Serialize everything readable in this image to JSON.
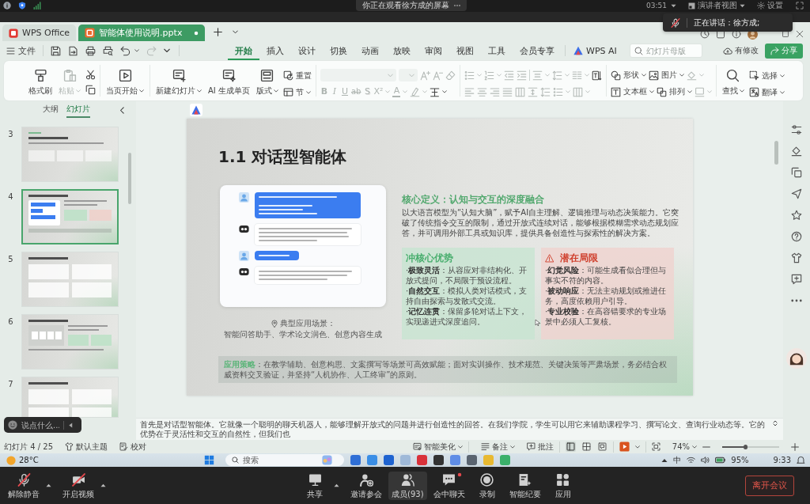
{
  "meeting_top_bar": {
    "banner": "你正在观看徐方成的屏幕",
    "time": "03:51",
    "view_menu": "演讲者视图",
    "settings": "设置"
  },
  "speaking_toast": "正在讲话：徐方成;",
  "app_tabs": [
    {
      "kind": "home",
      "label": "WPS Office",
      "selected": false
    },
    {
      "kind": "document",
      "label": "智能体使用说明.pptx",
      "selected": true
    }
  ],
  "menu_bar": {
    "file": "文件",
    "quick_access": [
      {
        "kind": "save",
        "disabled": false
      },
      {
        "kind": "export",
        "disabled": false
      },
      {
        "kind": "print",
        "disabled": false
      },
      {
        "kind": "preview",
        "disabled": false
      },
      {
        "kind": "undo",
        "disabled": false
      },
      {
        "kind": "redo",
        "disabled": true
      }
    ],
    "tabs": [
      {
        "label": "开始",
        "selected": true
      },
      {
        "label": "插入",
        "selected": false
      },
      {
        "label": "设计",
        "selected": false
      },
      {
        "label": "切换",
        "selected": false
      },
      {
        "label": "动画",
        "selected": false
      },
      {
        "label": "放映",
        "selected": false
      },
      {
        "label": "审阅",
        "selected": false
      },
      {
        "label": "视图",
        "selected": false
      },
      {
        "label": "工具",
        "selected": false
      },
      {
        "label": "会员专享",
        "selected": false
      }
    ],
    "ai_tab": "WPS AI",
    "search": {
      "placeholder": "幻灯片母版"
    },
    "save_status": "有修改",
    "share": "分享"
  },
  "ribbon": {
    "tools": [
      {
        "kind": "format-painter",
        "label": "格式刷",
        "disabled": false
      },
      {
        "kind": "paste",
        "label": "粘贴",
        "disabled": true
      },
      {
        "kind": "play-current",
        "label": "当页开始",
        "disabled": false
      },
      {
        "kind": "new-slide",
        "label": "新建幻灯片",
        "disabled": false
      },
      {
        "kind": "ai-page",
        "label": "AI 生成单页",
        "disabled": false
      },
      {
        "kind": "layout",
        "label": "版式",
        "disabled": false
      }
    ],
    "reset": "重置",
    "section": "节",
    "format_disabled": true,
    "font_glyphs": [
      "B",
      "I",
      "U",
      "ab",
      "S",
      "X²",
      "A"
    ],
    "drawing_tools": [
      "形状",
      "图片",
      "文本框",
      "排列"
    ],
    "find": "查找",
    "select": "选择",
    "translate": "翻译"
  },
  "left_panel": {
    "tabs": [
      {
        "label": "大纲",
        "selected": false
      },
      {
        "label": "幻灯片",
        "selected": true
      }
    ],
    "thumbnails": [
      {
        "number": "3",
        "kind": "columns",
        "selected": false
      },
      {
        "number": "4",
        "kind": "chat",
        "selected": true
      },
      {
        "number": "5",
        "kind": "grid",
        "selected": false
      },
      {
        "number": "6",
        "kind": "split",
        "selected": false
      },
      {
        "number": "7",
        "kind": "grid",
        "selected": false
      }
    ]
  },
  "slide": {
    "title": "1.1 对话型智能体",
    "chat": [
      {
        "kind": "user",
        "short": false
      },
      {
        "kind": "bot",
        "short": false
      },
      {
        "kind": "user",
        "short": true
      },
      {
        "kind": "bot",
        "short": true
      }
    ],
    "scene_label": "典型应用场景：",
    "scenes": "智能问答助手、学术论文润色、创意内容生成",
    "definition_title": "核心定义：认知与交互的深度融合",
    "definition": "以大语言模型为“认知大脑”，赋予AI自主理解、逻辑推理与动态决策能力。它突破了传统指令交互的限制，通过开放式连续对话，能够根据模糊需求动态规划应答，并可调用外部工具或知识库，提供具备创造性与探索性的解决方案。",
    "boxes": [
      {
        "kind": "advantages",
        "title": "冲核心优势",
        "items": [
          "·**极致灵活**：从容应对非结构化、开放式提问，不局限于预设流程。",
          "·**自然交互**：模拟人类对话模式，支持自由探索与发散式交流。",
          "·**记忆连贯**：保留多轮对话上下文，实现递进式深度追问。"
        ]
      },
      {
        "kind": "limitations",
        "title": "潜在局限",
        "items": [
          "·**幻觉风险**：可能生成看似合理但与事实不符的内容。",
          "·**被动响应**：无法主动规划或推进任务，高度依赖用户引导。",
          "·**专业校验**：在高容错要求的专业场景中必须人工复核。"
        ]
      }
    ],
    "strategy": {
      "label": "应用策略",
      "text": "：在教学辅助、创意构思、文案撰写等场景可高效赋能；面对实训操作、技术规范、关键决策等严肃场景，务必结合权威资料交叉验证，并坚持“人机协作、人工终审”的原则。"
    }
  },
  "notes": "首先是对话型智能体。它就像一个聪明的聊天机器人，能够理解开放式的问题并进行创造性的回答。在我们学院，学生可以用它来辅助课程学习、撰写论文、查询行业动态等。它的优势在于灵活性和交互的自然性，但我们也",
  "chat_input": {
    "placeholder": "说点什么..."
  },
  "status_bar": {
    "slide_counter": "幻灯片 4 / 25",
    "theme": "默认主题",
    "proofread": "校对",
    "beautify": "智能美化",
    "notes": "备注",
    "comments": "批注",
    "views": [
      {
        "kind": "normal",
        "selected": true
      },
      {
        "kind": "sorter",
        "selected": false
      },
      {
        "kind": "reading",
        "selected": false
      }
    ],
    "zoom": "74%",
    "zoom_slider": {
      "level": 0.4
    }
  },
  "taskbar": {
    "weather": "28°C",
    "search": {
      "placeholder": "搜索"
    },
    "input_method": "中",
    "battery": "95%",
    "time": "9:33"
  },
  "meeting_toolbar": {
    "left": [
      {
        "kind": "mute",
        "label": "解除静音"
      },
      {
        "kind": "video",
        "label": "开启视频"
      }
    ],
    "center": [
      {
        "kind": "share",
        "label": "共享",
        "selected": false,
        "unread": false
      },
      {
        "kind": "invite",
        "label": "邀请参会",
        "selected": false,
        "unread": false
      },
      {
        "kind": "members",
        "label": "成员(93)",
        "selected": true,
        "unread": false
      },
      {
        "kind": "chat",
        "label": "会中聊天",
        "selected": false,
        "unread": true
      },
      {
        "kind": "record",
        "label": "录制",
        "selected": false,
        "unread": false
      },
      {
        "kind": "minutes",
        "label": "智能纪要",
        "selected": false,
        "unread": false
      },
      {
        "kind": "apps",
        "label": "应用",
        "selected": false,
        "unread": false
      }
    ],
    "leave": "离开会议"
  }
}
